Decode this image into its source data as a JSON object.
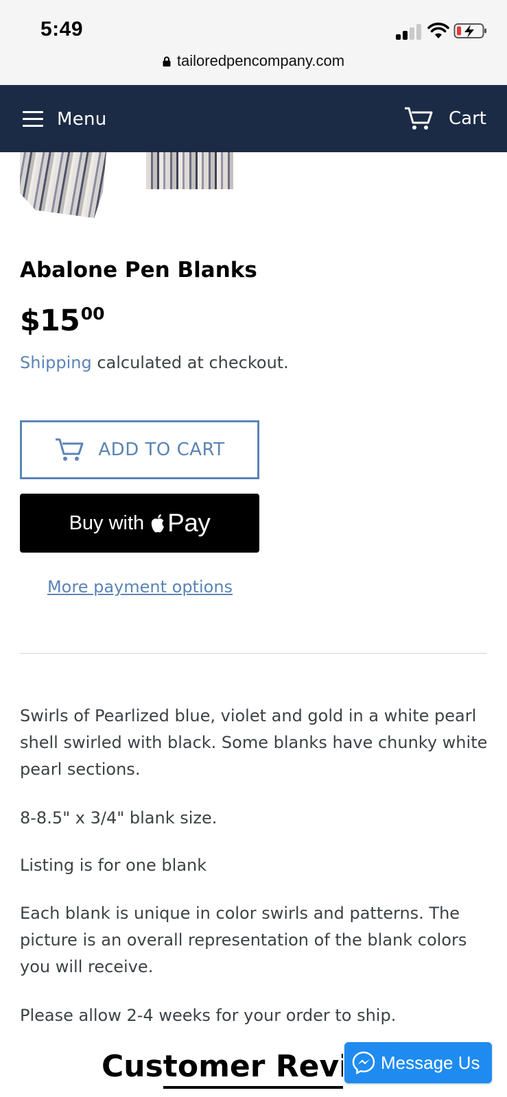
{
  "status_bar": {
    "time": "5:49",
    "icons": [
      "cellular-signal-icon",
      "wifi-icon",
      "battery-charging-icon"
    ]
  },
  "browser": {
    "url": "tailoredpencompany.com"
  },
  "nav": {
    "menu_label": "Menu",
    "cart_label": "Cart",
    "background_color": "#1c2b45"
  },
  "product": {
    "title": "Abalone Pen Blanks",
    "price_main": "$15",
    "price_cents": "00",
    "shipping_link": "Shipping",
    "shipping_text": " calculated at checkout.",
    "add_to_cart_label": "ADD TO CART",
    "apple_pay_buy": "Buy with",
    "apple_pay_pay": "Pay",
    "more_payment_label": "More payment options",
    "description": [
      "Swirls of Pearlized blue, violet and gold in a white pearl shell swirled with black. Some blanks have chunky white pearl sections.",
      "8-8.5\" x 3/4\" blank size.",
      "Listing is for one blank",
      "Each blank is unique in color swirls and patterns. The picture is an overall representation of the blank colors you will receive.",
      "Please allow 2-4 weeks for your order to ship."
    ]
  },
  "reviews": {
    "heading": "Customer Revie"
  },
  "messenger": {
    "label": "Message Us",
    "color": "#1f8bf0"
  },
  "colors": {
    "link": "#5b84b5",
    "text": "#3d4246"
  }
}
